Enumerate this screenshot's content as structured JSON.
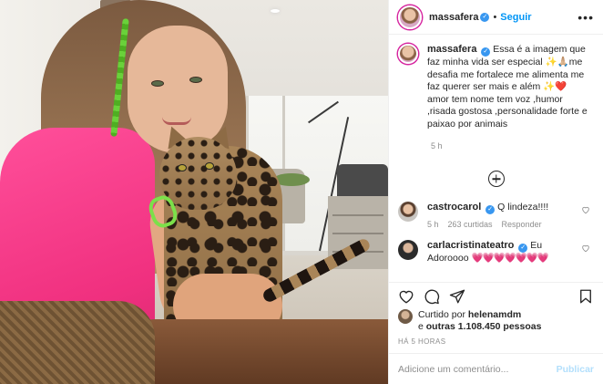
{
  "post": {
    "username": "massafera",
    "follow_label": "Seguir",
    "dot": "•",
    "more_glyph": "•••",
    "verified_glyph": "✓"
  },
  "caption": {
    "username": "massafera",
    "text": "Essa é a imagem que faz minha vida ser especial ✨🙏🏼me desafia me fortalece me alimenta me faz querer ser mais e além ✨❤️ amor tem nome tem voz ,humor ,risada gostosa ,personalidade forte e paixao por animais",
    "time": "5 h"
  },
  "comments": [
    {
      "username": "castrocarol",
      "text": "Q lindeza!!!!",
      "time": "5 h",
      "likes": "263 curtidas",
      "reply": "Responder"
    },
    {
      "username": "carlacristinateatro",
      "text": "Eu Adoroooo",
      "hearts": "💗💗💗💗💗💗💗"
    }
  ],
  "likes": {
    "prefix": "Curtido por",
    "user": "helenamdm",
    "middle": "e",
    "others": "outras 1.108.450 pessoas"
  },
  "time_ago": "HÁ 5 HORAS",
  "comment_box": {
    "placeholder": "Adicione um comentário...",
    "publish_label": "Publicar"
  },
  "colors": {
    "accent": "#0095f6",
    "verified": "#3897f0",
    "publish_disabled": "#b2dffc",
    "muted": "#8e8e8e"
  }
}
